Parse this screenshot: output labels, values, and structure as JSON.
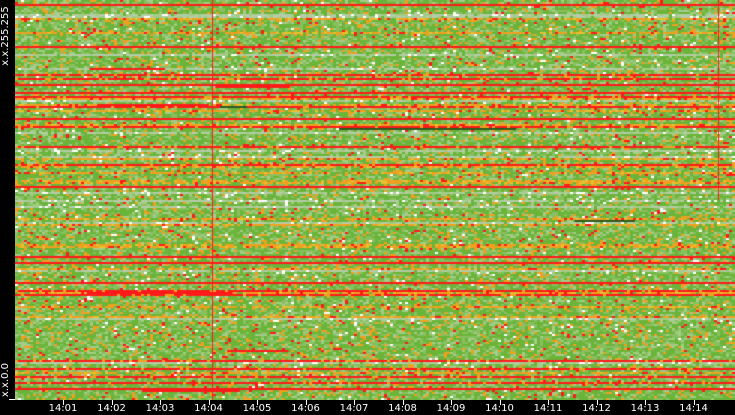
{
  "chart_data": {
    "type": "heatmap",
    "title": "",
    "xlabel": "",
    "ylabel": "",
    "x_ticks": [
      "14:01",
      "14:02",
      "14:03",
      "14:04",
      "14:05",
      "14:06",
      "14:07",
      "14:08",
      "14:09",
      "14:10",
      "14:11",
      "14:12",
      "14:13",
      "14:14"
    ],
    "y_labels": {
      "top": "x.x.255.255",
      "bottom": "x.x.0.0"
    },
    "color_scale": {
      "low": "#ffffff",
      "light": "#a4cc88",
      "mid": "#6ab43a",
      "high": "#f0a020",
      "max": "#ff1a1a",
      "dark": "#2d5a1e"
    },
    "grid": false
  }
}
